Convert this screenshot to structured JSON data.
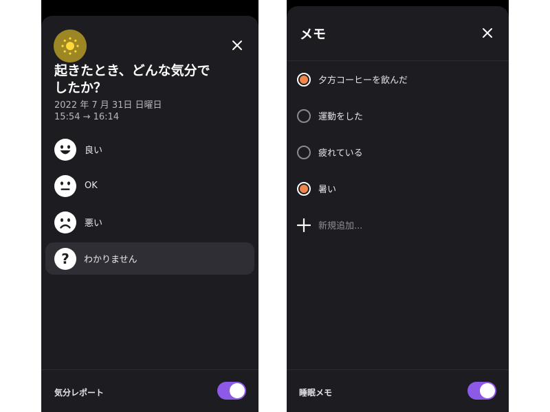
{
  "mood_sheet": {
    "title": "起きたとき、どんな気分でしたか？",
    "date": "2022 年 7 月 31日 日曜日",
    "time_range": "15:54 → 16:14",
    "options": [
      {
        "label": "良い",
        "icon": "happy-face-icon"
      },
      {
        "label": "OK",
        "icon": "neutral-face-icon"
      },
      {
        "label": "悪い",
        "icon": "sad-face-icon"
      },
      {
        "label": "わかりません",
        "icon": "question-icon",
        "selected": true
      }
    ],
    "footer_label": "気分レポート",
    "toggle_on": true
  },
  "memo_sheet": {
    "title": "メモ",
    "items": [
      {
        "label": "夕方コーヒーを飲んだ",
        "checked": true
      },
      {
        "label": "運動をした",
        "checked": false
      },
      {
        "label": "疲れている",
        "checked": false
      },
      {
        "label": "暑い",
        "checked": true
      }
    ],
    "add_label": "新規追加...",
    "footer_label": "睡眠メモ",
    "toggle_on": true
  },
  "colors": {
    "sheet_bg": "#1c1c21",
    "accent_toggle": "#8d5ae8",
    "radio_fill": "#f0874a",
    "sun_icon_bg": "#9d8624"
  }
}
